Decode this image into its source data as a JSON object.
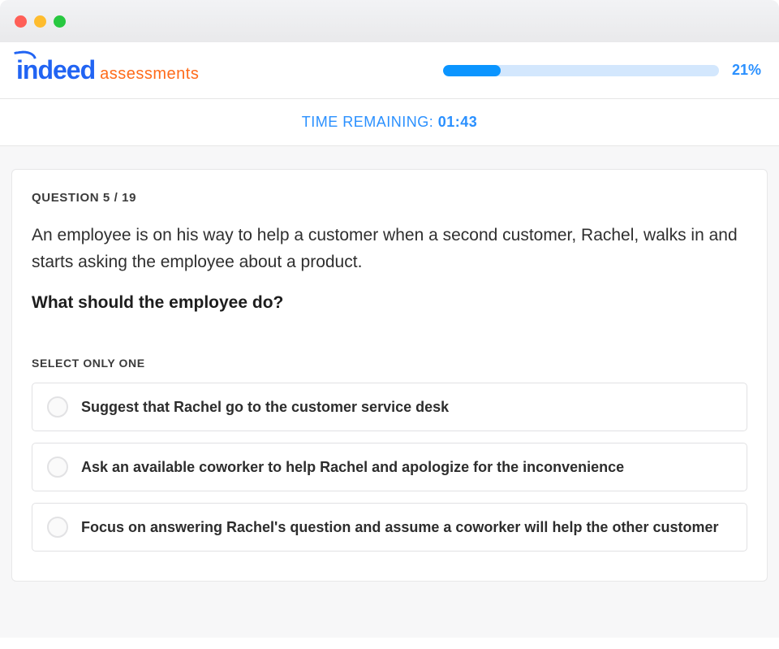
{
  "brand": {
    "name": "indeed",
    "sub": "assessments"
  },
  "progress": {
    "percent_label": "21%",
    "fill_width": "21%"
  },
  "timer": {
    "label": "TIME REMAINING: ",
    "value": "01:43"
  },
  "question": {
    "counter": "QUESTION 5 / 19",
    "scenario": "An employee is on his way to help a customer when a second customer, Rachel, walks in and starts asking the employee about a product.",
    "prompt": "What should the employee do?",
    "select_hint": "SELECT ONLY ONE",
    "options": [
      "Suggest that Rachel go to the customer service desk",
      "Ask an available coworker to help Rachel and apologize for the inconvenience",
      "Focus on answering Rachel's question and assume a coworker will help the other customer"
    ]
  }
}
